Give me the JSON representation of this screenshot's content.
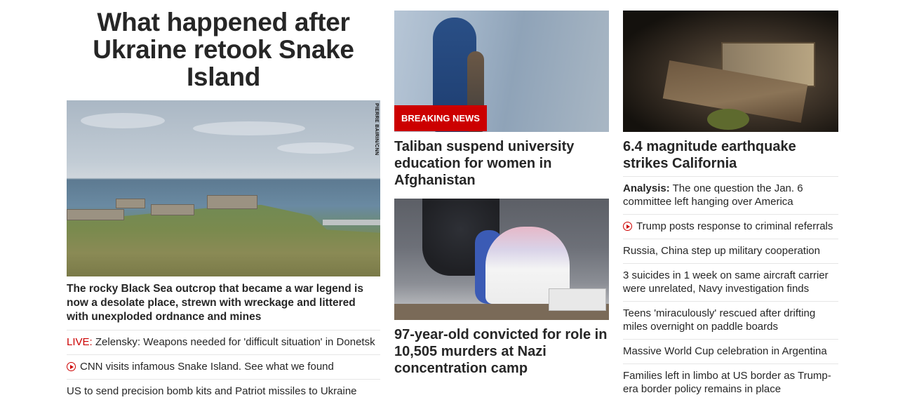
{
  "left": {
    "headline": "What happened after Ukraine retook Snake Island",
    "image_credit": "PIERRE BAIRIN/CNN",
    "summary": "The rocky Black Sea outcrop that became a war legend is now a desolate place, strewn with wreckage and littered with unexploded ordnance and mines",
    "links": [
      {
        "prefix": "LIVE:",
        "text": " Zelensky: Weapons needed for 'difficult situation' in Donetsk"
      },
      {
        "icon": "play-icon",
        "text": "CNN visits infamous Snake Island. See what we found"
      },
      {
        "text": "US to send precision bomb kits and Patriot missiles to Ukraine"
      }
    ]
  },
  "middle": {
    "breaking_label": "BREAKING NEWS",
    "story1_headline": "Taliban suspend university education for women in Afghanistan",
    "story2_headline": "97-year-old convicted for role in 10,505 murders at Nazi concentration camp"
  },
  "right": {
    "headline": "6.4 magnitude earthquake strikes California",
    "stories": [
      {
        "prefix": "Analysis:",
        "text": " The one question the Jan. 6 committee left hanging over America"
      },
      {
        "icon": "play-icon",
        "text": "Trump posts response to criminal referrals"
      },
      {
        "text": "Russia, China step up military cooperation"
      },
      {
        "text": "3 suicides in 1 week on same aircraft carrier were unrelated, Navy investigation finds"
      },
      {
        "text": "Teens 'miraculously' rescued after drifting miles overnight on paddle boards"
      },
      {
        "text": "Massive World Cup celebration in Argentina"
      },
      {
        "text": "Families left in limbo at US border as Trump-era border policy remains in place"
      }
    ]
  },
  "colors": {
    "live_red": "#cc0000",
    "breaking_bg": "#cc0000",
    "text": "#262626",
    "divider": "#e6e6e6"
  }
}
